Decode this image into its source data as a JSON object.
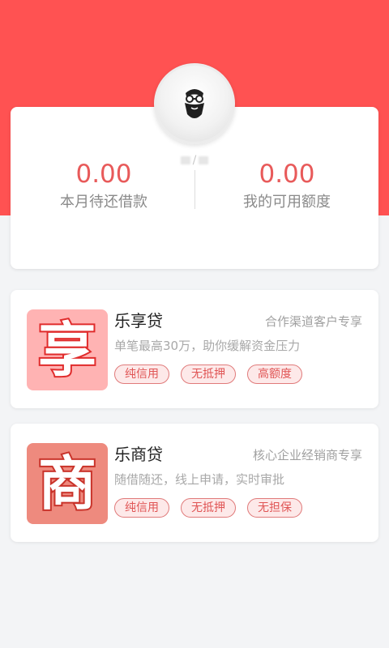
{
  "colors": {
    "accent": "#ff5252",
    "value_red": "#e85a5a"
  },
  "profile": {
    "avatar_icon": "bearded-man-icon",
    "username_masked": "/"
  },
  "summary": {
    "left_value": "0.00",
    "left_label": "本月待还借款",
    "right_value": "0.00",
    "right_label": "我的可用额度"
  },
  "products": [
    {
      "icon_char": "享",
      "name": "乐享贷",
      "tagline": "合作渠道客户专享",
      "description": "单笔最高30万，助你缓解资金压力",
      "tags": [
        "纯信用",
        "无抵押",
        "高额度"
      ]
    },
    {
      "icon_char": "商",
      "name": "乐商贷",
      "tagline": "核心企业经销商专享",
      "description": "随借随还，线上申请，实时审批",
      "tags": [
        "纯信用",
        "无抵押",
        "无担保"
      ]
    }
  ]
}
